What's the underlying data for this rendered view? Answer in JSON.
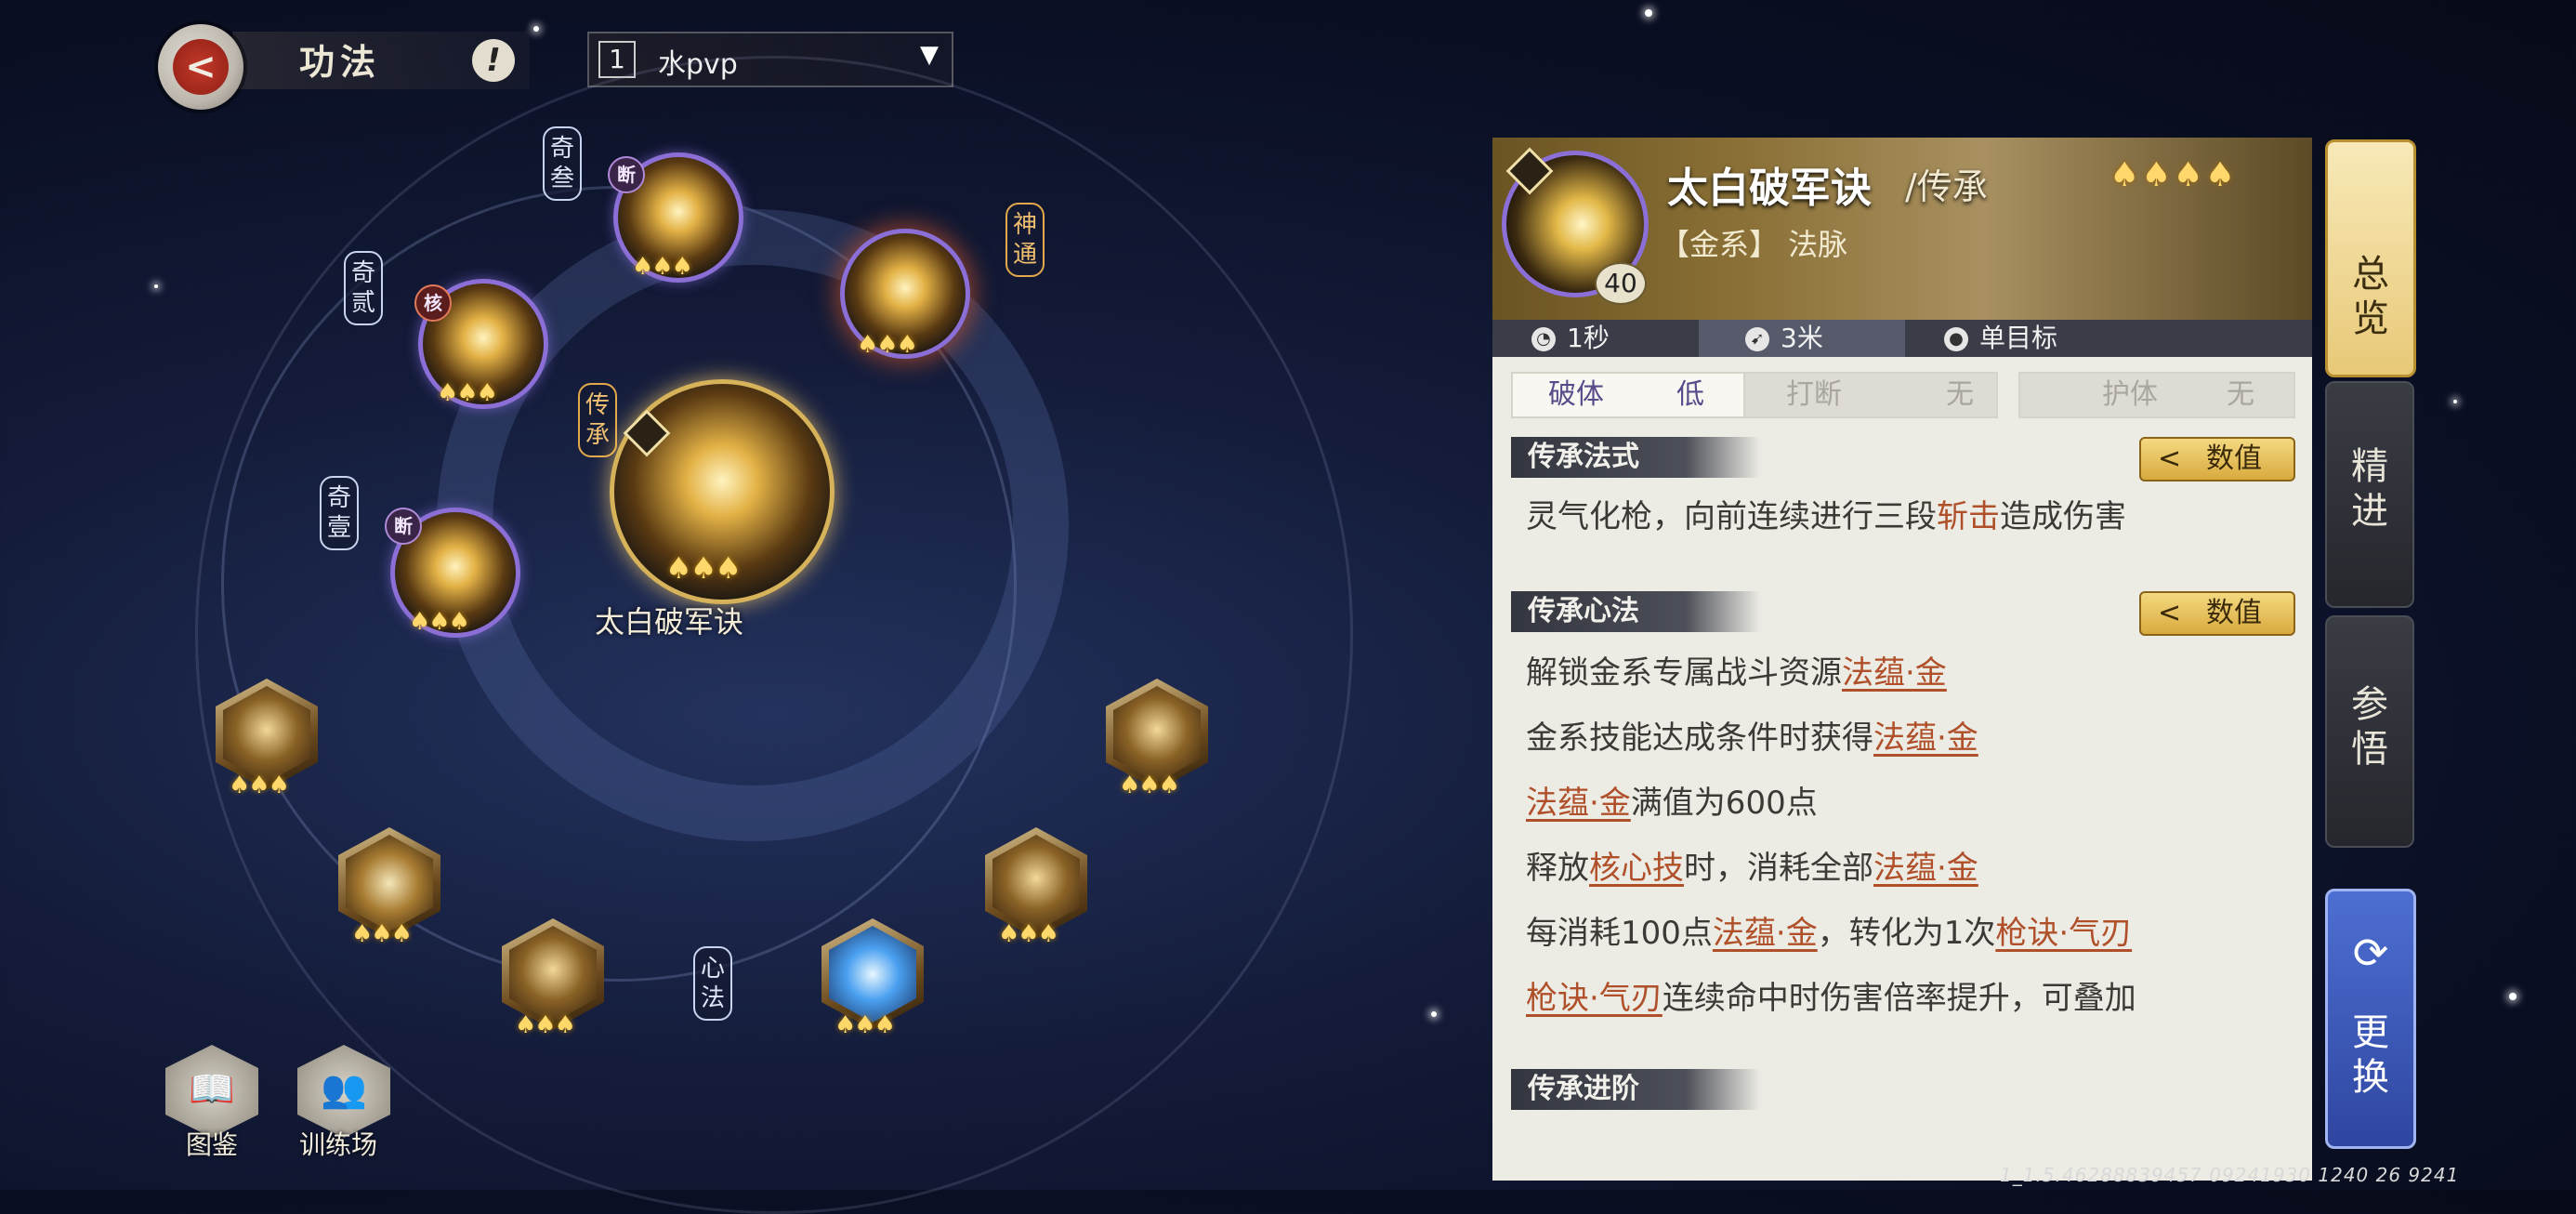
{
  "header": {
    "title": "功法",
    "info_glyph": "!",
    "preset": {
      "number": "1",
      "name": "水pvp"
    }
  },
  "wheel": {
    "center_label": "太白破军诀",
    "tags": {
      "qi_san": "奇叁",
      "qi_er": "奇贰",
      "qi_yi": "奇壹",
      "shen_tong": "神通",
      "chuan_cheng": "传承",
      "xin_fa": "心法"
    },
    "badges": {
      "duan": "断",
      "he": "核"
    },
    "flames": "♠♠♠"
  },
  "tools": {
    "codex": "图鉴",
    "training": "训练场"
  },
  "detail": {
    "name": "太白破军诀",
    "type": "/传承",
    "element": "【金系】 法脉",
    "level": "40",
    "lotus": "♠♠♠♠",
    "stats": {
      "cast_time": "1秒",
      "range": "3米",
      "target": "单目标"
    },
    "attrs": [
      {
        "name": "破体",
        "value": "低"
      },
      {
        "name": "打断",
        "value": "无"
      },
      {
        "name": "护体",
        "value": "无"
      }
    ],
    "value_button": "数值",
    "value_chevron": "<",
    "sections": {
      "style": "传承法式",
      "mind": "传承心法",
      "advance": "传承进阶"
    },
    "style_line": {
      "a": "灵气化枪，向前连续进行三段",
      "kw": "斩击",
      "b": "造成伤害"
    },
    "mind_lines": {
      "l1_a": "解锁金系专属战斗资源",
      "l1_kw": "法蕴·金",
      "l2_a": "金系技能达成条件时获得",
      "l2_kw": "法蕴·金",
      "l3_kw": "法蕴·金",
      "l3_b": "满值为600点",
      "l4_a": "释放",
      "l4_kw1": "核心技",
      "l4_b": "时，消耗全部",
      "l4_kw2": "法蕴·金",
      "l5_a": "每消耗100点",
      "l5_kw1": "法蕴·金",
      "l5_b": "，转化为1次",
      "l5_kw2": "枪诀·气刃",
      "l6_kw": "枪诀·气刃",
      "l6_b": "连续命中时伤害倍率提升，可叠加"
    }
  },
  "side_tabs": {
    "overview": "总览",
    "refine": "精进",
    "insight": "参悟",
    "swap": "更换"
  },
  "version": "1_1.5.46288839457 09241930 1240 26 9241",
  "colors": {
    "accent_gold": "#e8c978",
    "keyword": "#b0502a",
    "swap_blue": "#3a58c0"
  }
}
